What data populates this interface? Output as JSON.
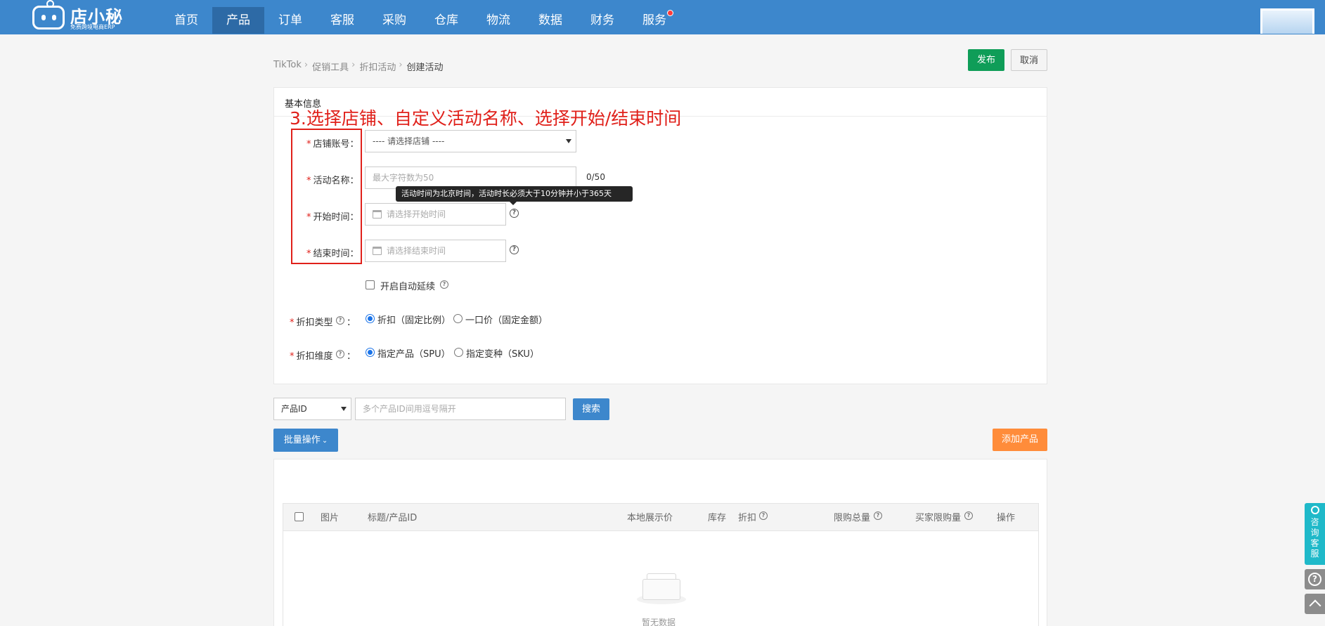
{
  "header": {
    "logo_name": "店小秘",
    "logo_sub": "免费跨境电商ERP",
    "nav": [
      "首页",
      "产品",
      "订单",
      "客服",
      "采购",
      "仓库",
      "物流",
      "数据",
      "财务",
      "服务"
    ],
    "active_nav": "产品"
  },
  "breadcrumb": {
    "items": [
      "TikTok",
      "促销工具",
      "折扣活动"
    ],
    "current": "创建活动"
  },
  "actions": {
    "publish": "发布",
    "cancel": "取消"
  },
  "basic_info": {
    "title": "基本信息",
    "annotation": "3.选择店铺、自定义活动名称、选择开始/结束时间",
    "shop_label": "店铺账号",
    "shop_placeholder": "---- 请选择店铺 ----",
    "name_label": "活动名称",
    "name_placeholder": "最大字符数为50",
    "name_counter": "0/50",
    "tooltip": "活动时间为北京时间，活动时长必须大于10分钟并小于365天",
    "start_label": "开始时间",
    "start_placeholder": "请选择开始时间",
    "end_label": "结束时间",
    "end_placeholder": "请选择结束时间",
    "auto_renew": "开启自动延续",
    "discount_type_label": "折扣类型",
    "discount_type_options": [
      "折扣（固定比例）",
      "一口价（固定金额）"
    ],
    "discount_type_selected": 0,
    "dimension_label": "折扣维度",
    "dimension_options": [
      "指定产品（SPU）",
      "指定变种（SKU）"
    ],
    "dimension_selected": 0,
    "colon": "："
  },
  "search": {
    "field": "产品ID",
    "placeholder": "多个产品ID间用逗号隔开",
    "button": "搜索"
  },
  "batch_label": "批量操作",
  "add_product": "添加产品",
  "table": {
    "columns": [
      "图片",
      "标题/产品ID",
      "本地展示价",
      "库存",
      "折扣",
      "限购总量",
      "买家限购量",
      "操作"
    ],
    "empty": "暂无数据"
  },
  "floating": {
    "service": "咨询客服"
  },
  "colors": {
    "primary": "#3d87cc",
    "publish": "#0f9d58",
    "add": "#ff8c3a",
    "annotation": "#e0201a",
    "service": "#1fb9c9"
  }
}
